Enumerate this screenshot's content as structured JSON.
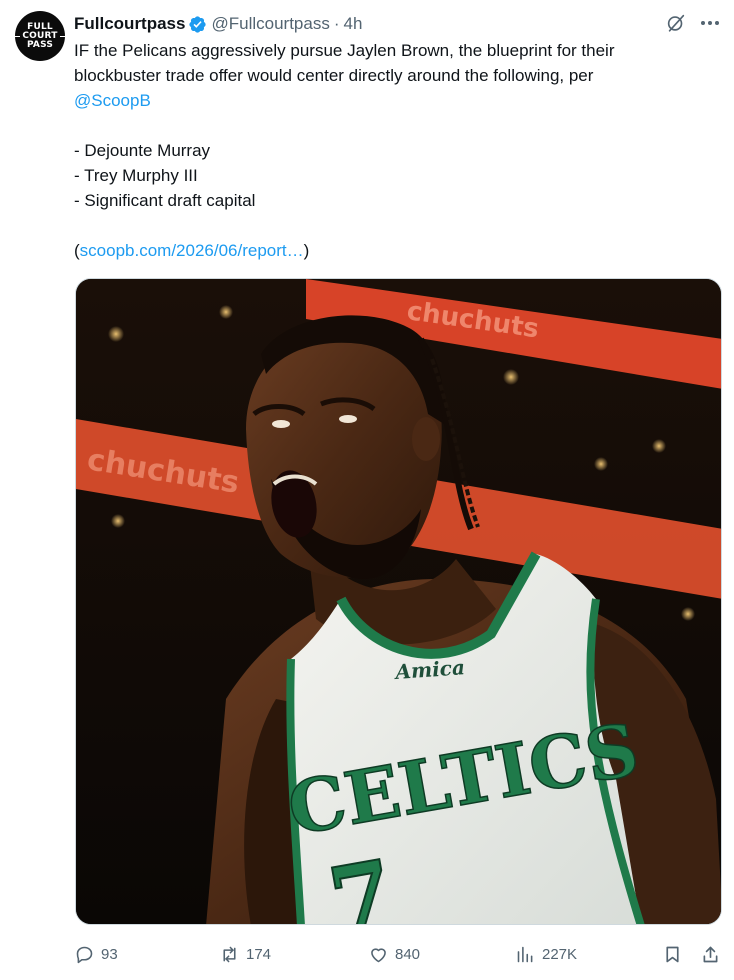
{
  "tweet": {
    "avatar_lines": [
      "FULL",
      "COURT",
      "PASS"
    ],
    "author_name": "Fullcourtpass",
    "handle": "@Fullcourtpass",
    "separator": "·",
    "time": "4h",
    "text_lines": [
      "IF the Pelicans aggressively pursue Jaylen Brown, the blueprint for their",
      "blockbuster trade offer would center directly around the following, per"
    ],
    "mention": "@ScoopB",
    "list_items": [
      "- Dejounte Murray",
      "- Trey Murphy III",
      "- Significant draft capital"
    ],
    "link_open": "(",
    "link_text": "scoopb.com/2026/06/report…",
    "link_close": ")",
    "media": {
      "jersey_wordmark": "CELTICS",
      "jersey_sponsor": "Amica",
      "arena_banner": "chuchuts"
    }
  },
  "actions": {
    "replies": "93",
    "retweets": "174",
    "likes": "840",
    "views": "227K"
  },
  "colors": {
    "accent": "#1d9bf0",
    "muted": "#536471",
    "text": "#0f1419",
    "celtics_green": "#1f7a4a"
  },
  "icons": [
    "verified-badge-icon",
    "grok-icon",
    "more-icon",
    "reply-icon",
    "retweet-icon",
    "like-icon",
    "views-icon",
    "bookmark-icon",
    "share-icon"
  ]
}
